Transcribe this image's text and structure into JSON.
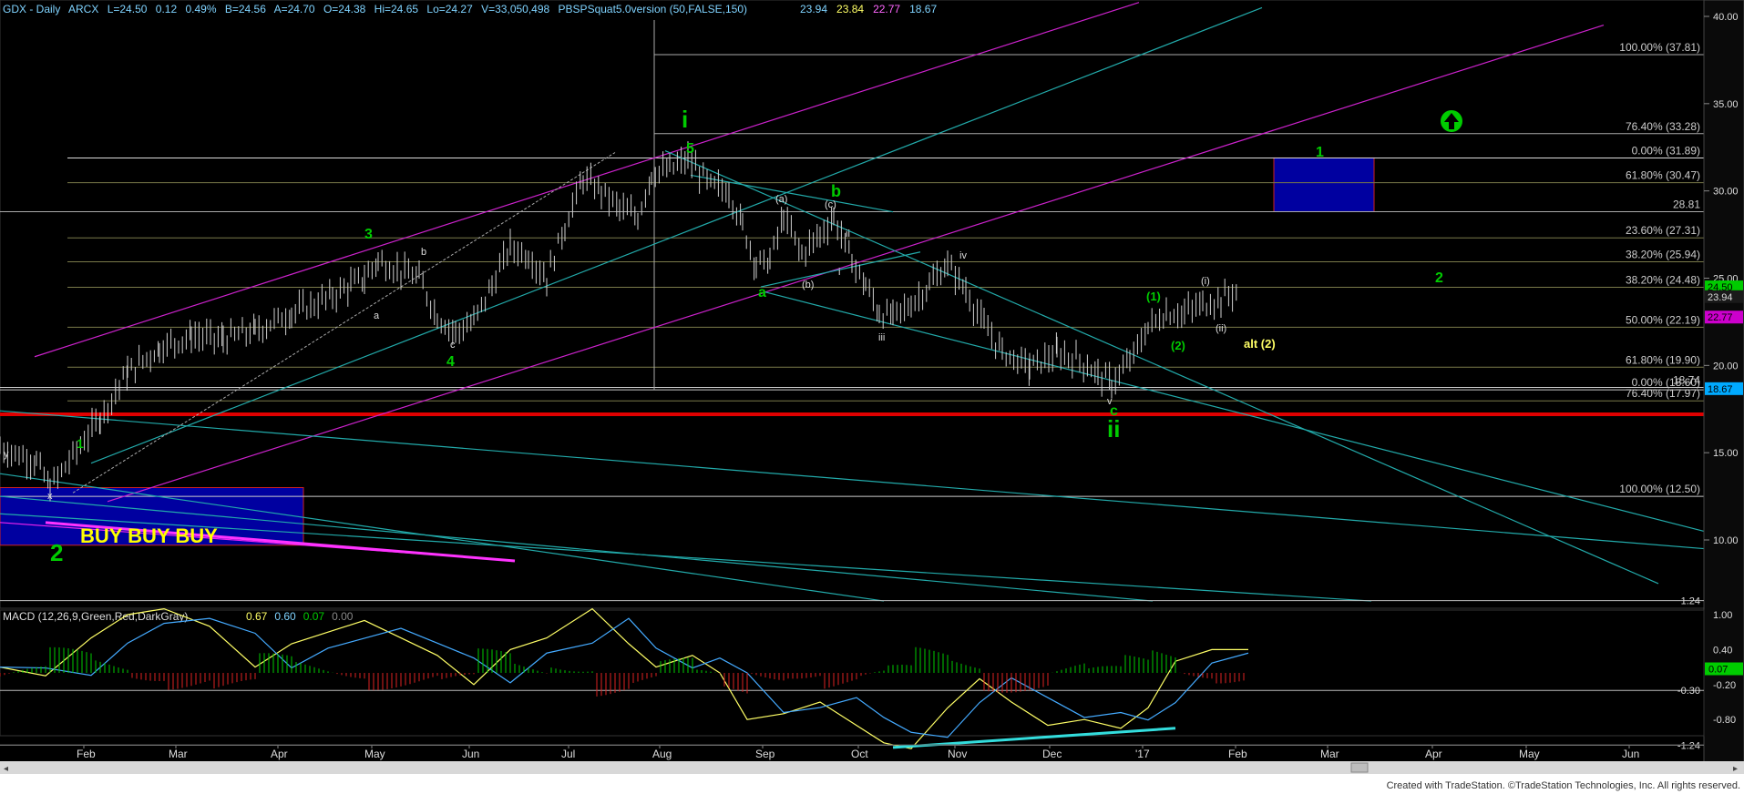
{
  "header": {
    "symbol": "GDX - Daily",
    "exchange": "ARCX",
    "last": "L=24.50",
    "change": "0.12",
    "pct": "0.49%",
    "bid": "B=24.56",
    "ask": "A=24.70",
    "open": "O=24.38",
    "high": "Hi=24.65",
    "low": "Lo=24.27",
    "volume": "V=33,050,498",
    "indicator": "PBSPSquat5.0version (50,FALSE,150)",
    "ind_values": [
      {
        "text": "23.94",
        "color": "#7fd3ff"
      },
      {
        "text": "23.84",
        "color": "#ffff66"
      },
      {
        "text": "22.77",
        "color": "#ff66ff"
      },
      {
        "text": "18.67",
        "color": "#7fd3ff"
      }
    ]
  },
  "macd_header": {
    "label": "MACD (12,26,9,Green,Red,DarkGray)",
    "values": [
      {
        "text": "0.67",
        "color": "#ffff66"
      },
      {
        "text": "0.60",
        "color": "#7fd3ff"
      },
      {
        "text": "0.07",
        "color": "#00cc00"
      },
      {
        "text": "0.00",
        "color": "#888888"
      }
    ]
  },
  "footer": {
    "credit": "Created with TradeStation. ©TradeStation Technologies, Inc. All rights reserved."
  },
  "chart_data": {
    "type": "candlestick",
    "symbol": "GDX",
    "interval": "Daily",
    "x_months": [
      "Feb",
      "Mar",
      "Apr",
      "May",
      "Jun",
      "Jul",
      "Aug",
      "Sep",
      "Oct",
      "Nov",
      "Dec",
      "'17",
      "Feb",
      "Mar",
      "Apr",
      "May",
      "Jun"
    ],
    "y_ticks": [
      40,
      35,
      30,
      25,
      20,
      15,
      10
    ],
    "ylim": [
      6.0,
      41.0
    ],
    "price_badges": [
      {
        "value": 24.5,
        "label": "24.50",
        "color": "#00cc00"
      },
      {
        "value": 23.94,
        "label": "23.94",
        "color": "#1a1a1a"
      },
      {
        "value": 22.77,
        "label": "22.77",
        "color": "#cc00cc"
      },
      {
        "value": 18.67,
        "label": "18.67",
        "color": "#00aaff"
      }
    ],
    "fib_levels": [
      {
        "value": 37.81,
        "label": "100.00% (37.81)"
      },
      {
        "value": 33.28,
        "label": "76.40% (33.28)"
      },
      {
        "value": 31.89,
        "label": "0.00% (31.89)"
      },
      {
        "value": 30.47,
        "label": "61.80% (30.47)"
      },
      {
        "value": 28.81,
        "label": "28.81"
      },
      {
        "value": 27.31,
        "label": "23.60% (27.31)"
      },
      {
        "value": 25.94,
        "label": "38.20% (25.94)"
      },
      {
        "value": 24.48,
        "label": "38.20% (24.48)"
      },
      {
        "value": 22.19,
        "label": "50.00% (22.19)"
      },
      {
        "value": 19.9,
        "label": "61.80% (19.90)"
      },
      {
        "value": 18.74,
        "label": "18.74"
      },
      {
        "value": 18.6,
        "label": "0.00% (18.60)"
      },
      {
        "value": 17.97,
        "label": "76.40% (17.97)"
      },
      {
        "value": 17.2,
        "label": "17.20"
      },
      {
        "value": 12.5,
        "label": "100.00% (12.50)"
      }
    ],
    "wave_labels": [
      {
        "text": "i",
        "x": "Aug",
        "price": 33.5,
        "color": "#00cc00"
      },
      {
        "text": "5",
        "x": "Aug",
        "price": 32.0,
        "color": "#00cc00"
      },
      {
        "text": "3",
        "x": "Apr",
        "price": 26.8,
        "color": "#00cc00"
      },
      {
        "text": "4",
        "x": "May",
        "price": 20.6,
        "color": "#00cc00"
      },
      {
        "text": "1",
        "x": "Jan-16",
        "price": 16.5,
        "color": "#00cc00"
      },
      {
        "text": "2",
        "x": "Jan-16",
        "price": 8.3,
        "color": "#00cc00"
      },
      {
        "text": "a",
        "x": "Aug",
        "price": 24.6,
        "color": "#00cc00"
      },
      {
        "text": "b",
        "x": "Sep",
        "price": 30.9,
        "color": "#00cc00"
      },
      {
        "text": "c",
        "x": "Dec",
        "price": 16.8,
        "color": "#00cc00"
      },
      {
        "text": "ii",
        "x": "Dec",
        "price": 14.8,
        "color": "#00cc00"
      },
      {
        "text": "1",
        "x": "Feb",
        "price": 32.1,
        "color": "#00cc00"
      },
      {
        "text": "2",
        "x": "Apr",
        "price": 25.2,
        "color": "#00cc00"
      },
      {
        "text": "(1)",
        "x": "Jan",
        "price": 24.0,
        "color": "#00cc00"
      },
      {
        "text": "(2)",
        "x": "Jan",
        "price": 21.2,
        "color": "#00cc00"
      },
      {
        "text": "alt (2)",
        "x": "Feb",
        "price": 21.8,
        "color": "#ffff66"
      },
      {
        "text": "BUY BUY BUY",
        "x": "Jan-16",
        "price": 10.8,
        "color": "#ffff00"
      }
    ],
    "blue_boxes": [
      {
        "from": "Jan-16",
        "to": "Apr",
        "ymin": 9.7,
        "ymax": 13.0,
        "color": "#000080"
      },
      {
        "from": "Feb",
        "to": "Mar",
        "ymin": 28.81,
        "ymax": 31.89,
        "color": "#000080"
      }
    ],
    "macd": {
      "labels": [
        {
          "text": "1.24",
          "value": 1.24
        },
        {
          "text": "1.00",
          "value": 1.0
        },
        {
          "text": "0.40",
          "value": 0.4
        },
        {
          "text": "0.07",
          "value": 0.07
        },
        {
          "text": "-0.30",
          "value": -0.3
        },
        {
          "text": "-0.20",
          "value": -0.2
        },
        {
          "text": "-0.80",
          "value": -0.8
        },
        {
          "text": "-1.24",
          "value": -1.24
        }
      ],
      "ylim": [
        -1.45,
        1.45
      ]
    }
  }
}
